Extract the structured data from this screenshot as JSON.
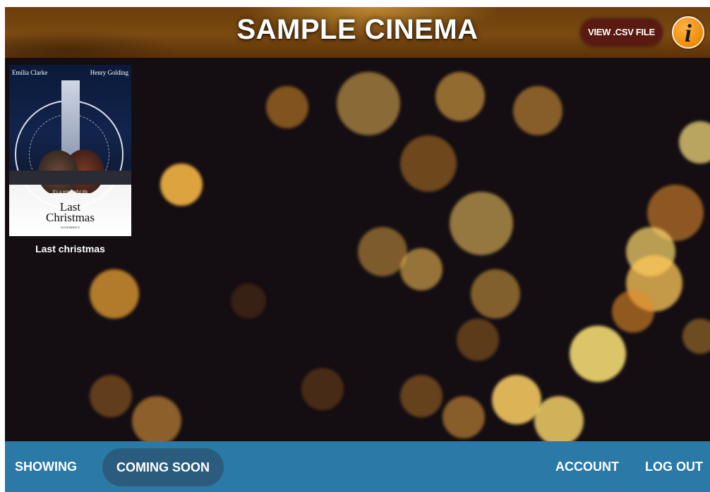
{
  "header": {
    "title": "SAMPLE CINEMA",
    "csv_button": "VIEW .CSV FILE",
    "info_icon": "info-icon",
    "info_glyph": "i"
  },
  "movies": [
    {
      "title": "Last christmas",
      "poster": {
        "actor_left": "Emilia Clarke",
        "actor_right": "Henry Golding",
        "tagline": "It's a wonderful life",
        "title_line1": "Last",
        "title_line2": "Christmas",
        "date": "NOVEMBER 8"
      }
    }
  ],
  "footer": {
    "showing": "SHOWING",
    "coming_soon": "COMING SOON",
    "account": "ACCOUNT",
    "logout": "LOG OUT",
    "active_tab": "COMING SOON"
  },
  "colors": {
    "header_brown": "#7c4a12",
    "csv_button": "#5a1a12",
    "info_orange": "#f08a06",
    "footer_blue": "#2a79a7",
    "active_tab": "#2c5c7d",
    "background": "#140d12"
  }
}
